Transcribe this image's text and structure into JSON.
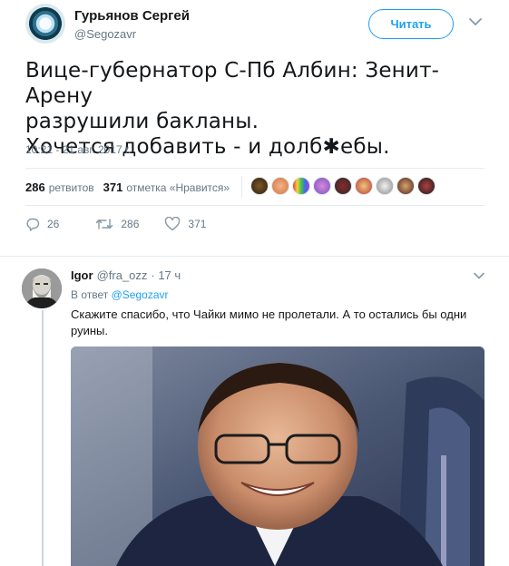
{
  "main_tweet": {
    "author_name": "Гурьянов Сергей",
    "author_handle": "@Segozavr",
    "follow_label": "Читать",
    "text_line1": "Вице-губернатор С-Пб Албин: Зенит-Арену",
    "text_line2": "разрушили бакланы.",
    "text_line3": "Хочется добавить - и долб✱ебы.",
    "timestamp": "10:21 - 21 авг. 2017 г.",
    "retweets_count": "286",
    "retweets_label": "ретвитов",
    "likes_count": "371",
    "likes_label": "отметка «Нравится»",
    "likers_count": 9,
    "actions": {
      "reply_count": "26",
      "retweet_count": "286",
      "like_count": "371"
    }
  },
  "reply": {
    "author_name": "Igor",
    "author_handle": "@fra_ozz",
    "time": "· 17 ч",
    "in_reply_prefix": "В ответ",
    "in_reply_handle": "@Segozavr",
    "text": "Скажите спасибо, что Чайки мимо не пролетали. А то остались бы одни руины."
  },
  "colors": {
    "accent": "#1da1f2",
    "secondary_text": "#657786",
    "divider": "#e6ecf0"
  },
  "icons": {
    "reply": "reply-icon",
    "retweet": "retweet-icon",
    "like": "heart-icon",
    "more": "chevron-down-icon"
  }
}
